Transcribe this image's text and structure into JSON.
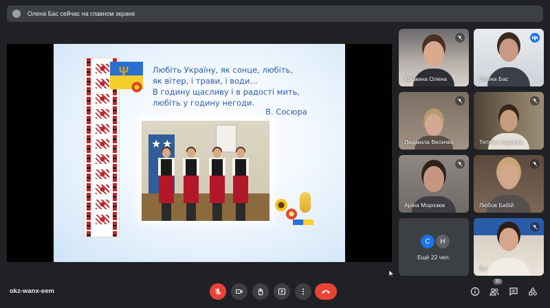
{
  "banner": {
    "text": "Олена Бас сейчас на главном экране"
  },
  "slide": {
    "poem_lines": [
      "Любіть Україну, як сонце, любіть,",
      "як вітер, і трави, і води…",
      "В годину щасливу і в радості мить,",
      "любіть у годину негоди."
    ],
    "author": "В. Сосюра"
  },
  "participants": [
    {
      "name": "Космина Олена",
      "muted": true,
      "speaking": false
    },
    {
      "name": "Олена Бас",
      "muted": false,
      "speaking": true
    },
    {
      "name": "Людмила Величко",
      "muted": true,
      "speaking": false
    },
    {
      "name": "Тетяна Фадєєва",
      "muted": true,
      "speaking": false
    },
    {
      "name": "Аріна Морозюк",
      "muted": true,
      "speaking": false
    },
    {
      "name": "Любов Бабій",
      "muted": true,
      "speaking": false
    },
    {
      "name": "Вы",
      "muted": true,
      "speaking": false
    }
  ],
  "more": {
    "avatars": [
      {
        "letter": "С",
        "color": "#1a73e8"
      },
      {
        "letter": "Н",
        "color": "#5f6368"
      }
    ],
    "label": "Ещё 22 чел."
  },
  "bottom_bar": {
    "meeting_code": "okz-wanx-eem",
    "people_count": "30"
  },
  "colors": {
    "background": "#202124",
    "tile": "#3c4043",
    "hangup": "#ea4335",
    "accent": "#8ab4f8"
  }
}
